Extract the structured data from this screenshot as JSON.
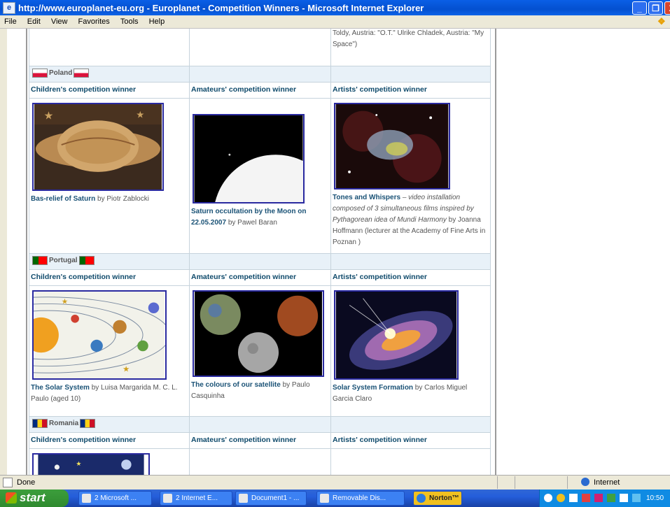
{
  "window": {
    "title": "http://www.europlanet-eu.org - Europlanet - Competition Winners - Microsoft Internet Explorer",
    "minimize": "_",
    "maximize": "❐",
    "close": "X"
  },
  "menu": [
    "File",
    "Edit",
    "View",
    "Favorites",
    "Tools",
    "Help"
  ],
  "top_row": {
    "artists_text": "Toldy, Austria: \"O.T.\" Ulrike Chladek, Austria: \"My Space\")"
  },
  "countries": [
    {
      "name": "Poland",
      "headers": [
        "Children's competition winner",
        "Amateurs' competition winner",
        "Artists' competition winner"
      ],
      "children": {
        "title": "Bas-relief of Saturn",
        "by": " by Piotr Zablocki"
      },
      "amateurs": {
        "title": "Saturn occultation by the Moon on 22.05.2007",
        "by": " by Pawel Baran"
      },
      "artists": {
        "title": "Tones and Whispers",
        "desc": " – video installation composed of 3 simultaneous films inspired by Pythagorean idea of Mundi Harmony",
        "by": " by Joanna Hoffmann (lecturer at the Academy of Fine Arts in Poznan )"
      }
    },
    {
      "name": "Portugal",
      "headers": [
        "Children's competition winner",
        "Amateurs' competition winner",
        "Artists' competition winner"
      ],
      "children": {
        "title": "The Solar System",
        "by": " by Luisa Margarida M. C. L. Paulo (aged 10)"
      },
      "amateurs": {
        "title": "The colours of our satellite",
        "by": " by Paulo Casquinha"
      },
      "artists": {
        "title": "Solar System Formation",
        "by": " by Carlos Miguel Garcia Claro"
      }
    },
    {
      "name": "Romania",
      "headers": [
        "Children's competition winner",
        "Amateurs' competition winner",
        "Artists' competition winner"
      ]
    }
  ],
  "status": {
    "text": "Done",
    "zone": "Internet"
  },
  "taskbar": {
    "start": "start",
    "tasks": [
      "2 Microsoft ...",
      "2 Internet E...",
      "Document1 - ...",
      "Removable Dis...",
      "Norton™"
    ],
    "clock": "10:50"
  },
  "colors": {
    "link": "#1a5276",
    "header": "#0f4a6b",
    "country_bg": "#e8f1f8",
    "image_border": "#2a2aa0"
  }
}
